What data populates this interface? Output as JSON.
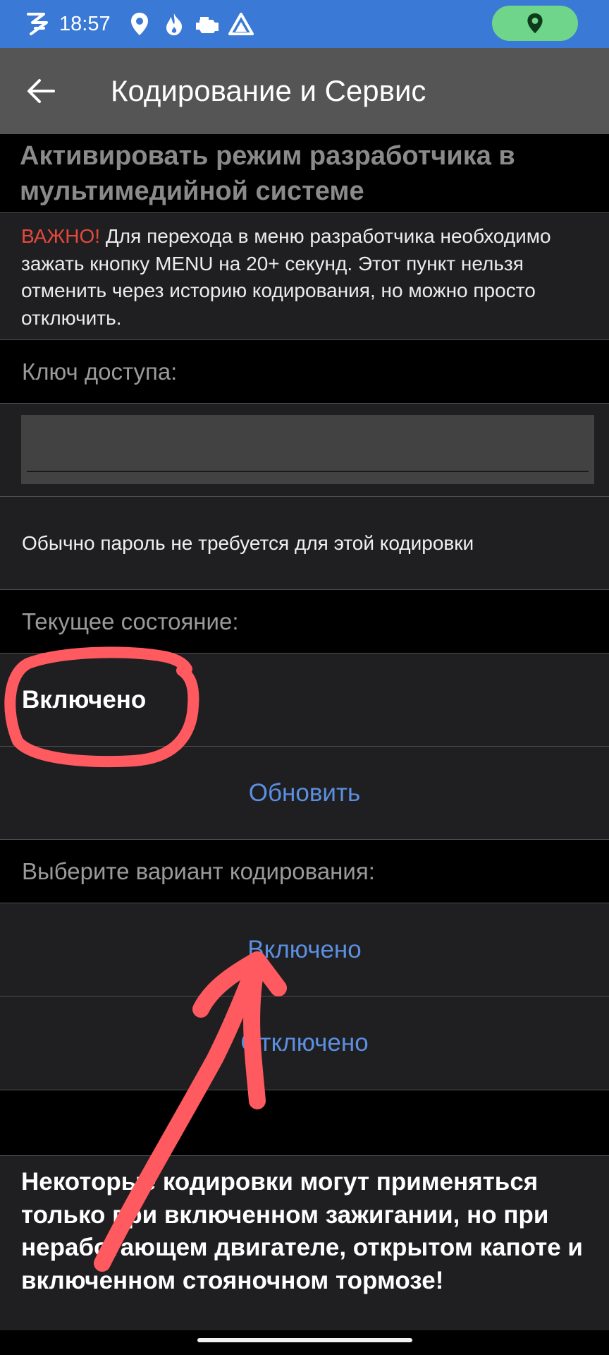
{
  "status_bar": {
    "time": "18:57",
    "icons": [
      "navigation-app-icon",
      "location-pin-icon",
      "flame-icon",
      "car-engine-icon",
      "android-auto-icon"
    ],
    "pill_icon": "location-pin-icon",
    "pill_color": "#6fd58a",
    "background": "#3a79d6"
  },
  "app_bar": {
    "back_icon": "arrow-left-icon",
    "title": "Кодирование и Сервис"
  },
  "section": {
    "title": "Активировать режим разработчика в мультимедийной системе"
  },
  "important": {
    "prefix": "ВАЖНО!",
    "text": " Для перехода в меню разработчика необходимо зажать кнопку MENU на 20+ секунд. Этот пункт нельзя отменить через историю кодирования, но можно просто отключить."
  },
  "access_key": {
    "label": "Ключ доступа:",
    "value": "",
    "hint": "Обычно пароль не требуется для этой кодировки"
  },
  "current_state": {
    "label": "Текущее состояние:",
    "value": "Включено",
    "refresh_label": "Обновить"
  },
  "coding": {
    "label": "Выберите вариант кодирования:",
    "options": [
      "Включено",
      "Отключено"
    ]
  },
  "footer": {
    "warning": "Некоторые кодировки могут применяться только при включенном зажигании, но при неработающем двигателе, открытом капоте и включенном стояночном тормозе!"
  },
  "colors": {
    "accent_link": "#5b8fe0",
    "warning_red": "#e5483d",
    "annotation_red": "#ff5a5f"
  }
}
